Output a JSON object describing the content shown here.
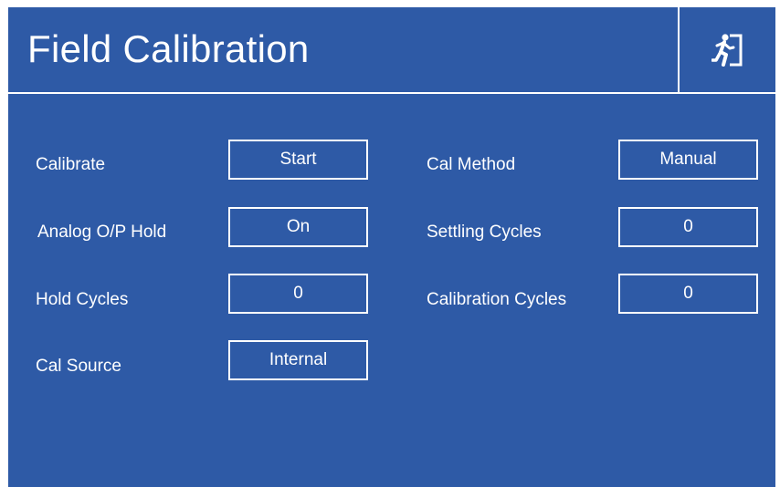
{
  "header": {
    "title": "Field Calibration",
    "exit_icon": "exit-door-icon"
  },
  "colors": {
    "background": "#2e5aa6",
    "foreground": "#ffffff"
  },
  "left_column": [
    {
      "label": "Calibrate",
      "value": "Start"
    },
    {
      "label": "Analog O/P Hold",
      "value": "On"
    },
    {
      "label": "Hold Cycles",
      "value": "0"
    },
    {
      "label": "Cal Source",
      "value": "Internal"
    }
  ],
  "right_column": [
    {
      "label": "Cal Method",
      "value": "Manual"
    },
    {
      "label": "Settling Cycles",
      "value": "0"
    },
    {
      "label": "Calibration Cycles",
      "value": "0"
    }
  ]
}
